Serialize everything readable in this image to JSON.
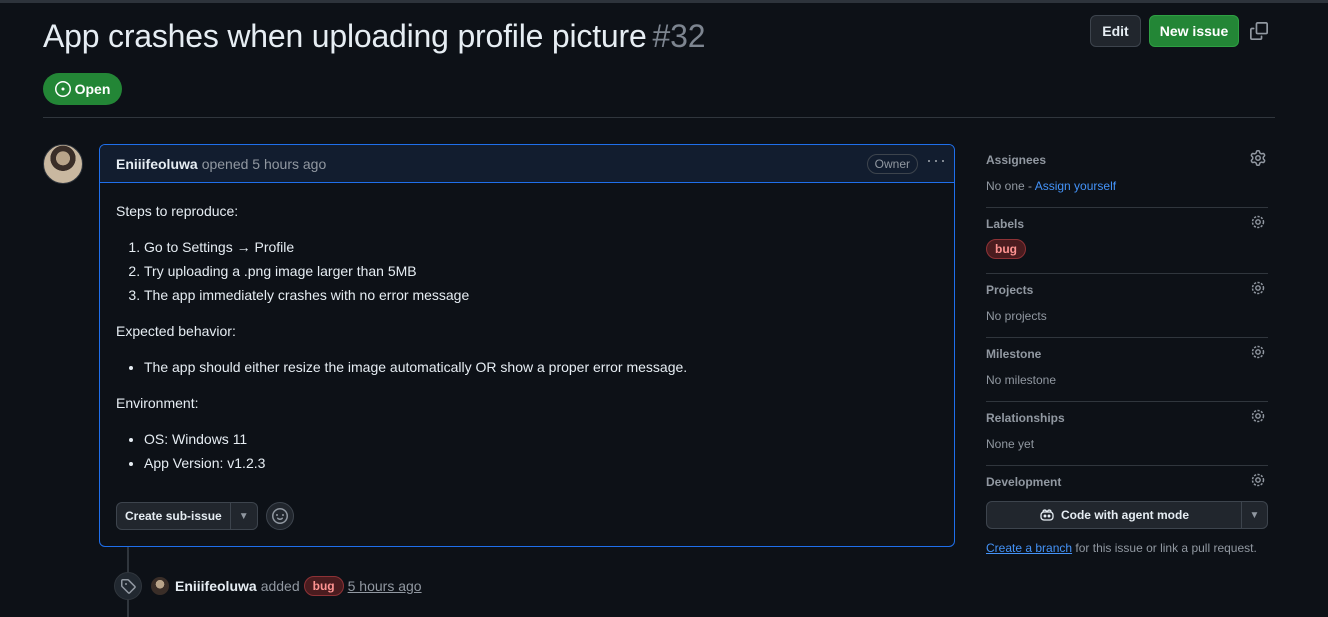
{
  "header": {
    "title": "App crashes when uploading profile picture",
    "number": "#32",
    "edit_label": "Edit",
    "new_issue_label": "New issue",
    "state_label": "Open"
  },
  "comment": {
    "author": "Eniiifeoluwa",
    "meta": "opened 5 hours ago",
    "role_badge": "Owner",
    "steps_heading": "Steps to reproduce:",
    "steps": [
      "Go to Settings → Profile",
      "Try uploading a .png image larger than 5MB",
      "The app immediately crashes with no error message"
    ],
    "expected_heading": "Expected behavior:",
    "expected": [
      "The app should either resize the image automatically OR show a proper error message."
    ],
    "env_heading": "Environment:",
    "env": [
      "OS: Windows 11",
      "App Version: v1.2.3"
    ],
    "sub_issue_label": "Create sub-issue"
  },
  "timeline": {
    "author": "Eniiifeoluwa",
    "action": "added",
    "label": "bug",
    "time": "5 hours ago"
  },
  "sidebar": {
    "assignees": {
      "title": "Assignees",
      "value": "No one - ",
      "link": "Assign yourself"
    },
    "labels": {
      "title": "Labels",
      "label": "bug"
    },
    "projects": {
      "title": "Projects",
      "value": "No projects"
    },
    "milestone": {
      "title": "Milestone",
      "value": "No milestone"
    },
    "relationships": {
      "title": "Relationships",
      "value": "None yet"
    },
    "development": {
      "title": "Development",
      "agent_label": "Code with agent mode",
      "branch_link": "Create a branch",
      "note": " for this issue or link a pull request."
    }
  },
  "colors": {
    "open_green": "#238636",
    "accent_blue": "#1f6feb",
    "link_blue": "#4493f8",
    "bug_label_text": "#ff9492"
  },
  "icons": [
    "copy-icon",
    "issue-open-icon",
    "kebab-icon",
    "smiley-icon",
    "tag-icon",
    "gear-icon",
    "copilot-icon",
    "caret-down-icon"
  ]
}
